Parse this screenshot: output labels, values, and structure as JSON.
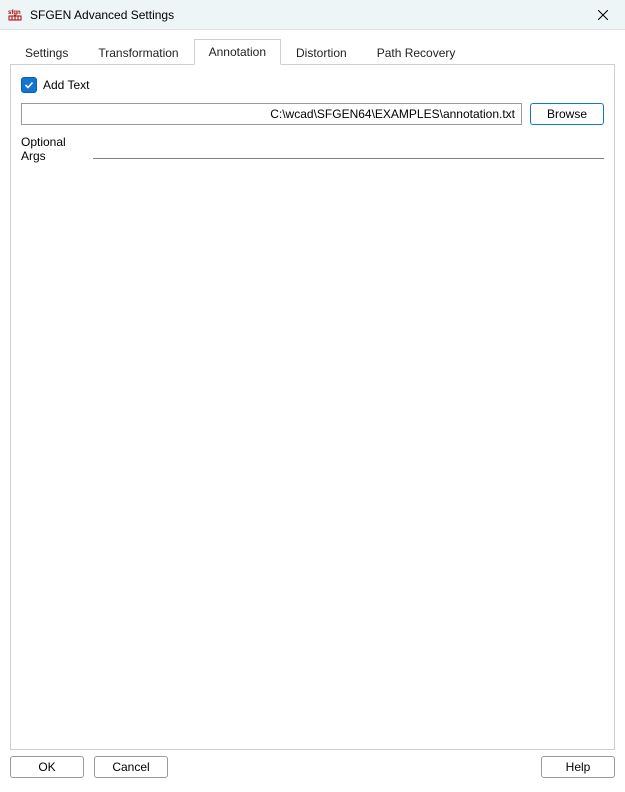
{
  "window": {
    "title": "SFGEN Advanced Settings"
  },
  "tabs": {
    "t0": "Settings",
    "t1": "Transformation",
    "t2": "Annotation",
    "t3": "Distortion",
    "t4": "Path Recovery",
    "active_index": 2
  },
  "annotation_panel": {
    "add_text_label": "Add Text",
    "add_text_checked": true,
    "path_value": "C:\\wcad\\SFGEN64\\EXAMPLES\\annotation.txt",
    "browse_label": "Browse",
    "optional_args_label": "Optional Args",
    "optional_args_value": ""
  },
  "footer": {
    "ok": "OK",
    "cancel": "Cancel",
    "help": "Help"
  }
}
